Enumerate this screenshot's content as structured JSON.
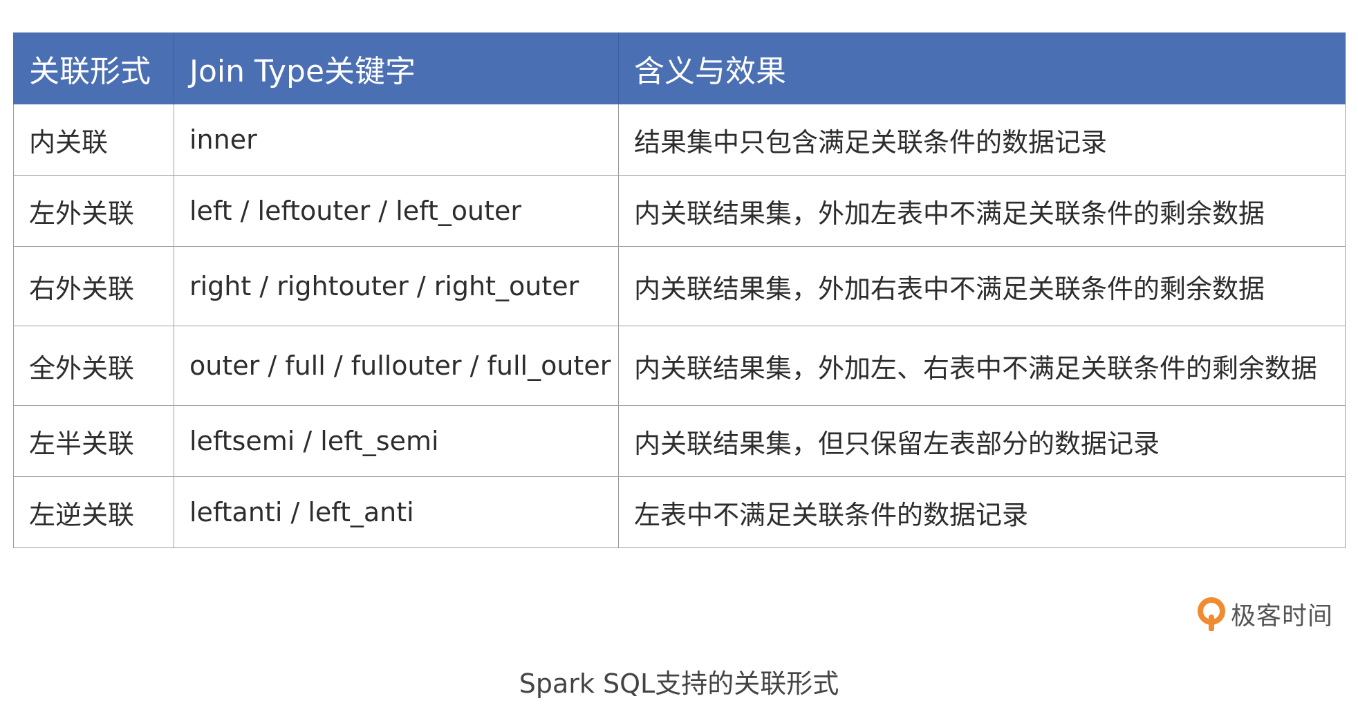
{
  "table": {
    "headers": [
      "关联形式",
      "Join Type关键字",
      "含义与效果"
    ],
    "rows": [
      [
        "内关联",
        "inner",
        "结果集中只包含满足关联条件的数据记录"
      ],
      [
        "左外关联",
        "left / leftouter / left_outer",
        "内关联结果集，外加左表中不满足关联条件的剩余数据"
      ],
      [
        "右外关联",
        "right / rightouter / right_outer",
        "内关联结果集，外加右表中不满足关联条件的剩余数据"
      ],
      [
        "全外关联",
        "outer / full / fullouter / full_outer",
        "内关联结果集，外加左、右表中不满足关联条件的剩余数据"
      ],
      [
        "左半关联",
        "leftsemi / left_semi",
        "内关联结果集，但只保留左表部分的数据记录"
      ],
      [
        "左逆关联",
        "leftanti / left_anti",
        "左表中不满足关联条件的数据记录"
      ]
    ]
  },
  "brand": {
    "name": "极客时间",
    "icon": "geektime-logo-icon"
  },
  "caption": "Spark SQL支持的关联形式",
  "colors": {
    "header_bg": "#4b6fb3",
    "header_text": "#ffffff",
    "border": "#9c9c9c",
    "brand_orange": "#f28a2e"
  }
}
